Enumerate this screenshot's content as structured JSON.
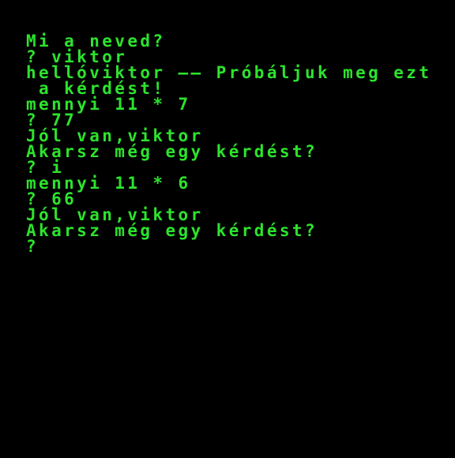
{
  "terminal": {
    "text_color": "#2de32d",
    "background_color": "#000000",
    "lines": [
      "Mi a neved?",
      "? viktor",
      "hellóviktor —— Próbáljuk meg ezt",
      " a kérdést!",
      "mennyi 11 * 7",
      "? 77",
      "Jól van,viktor",
      "Akarsz még egy kérdést?",
      "? i",
      "mennyi 11 * 6",
      "? 66",
      "Jól van,viktor",
      "Akarsz még egy kérdést?",
      "?"
    ]
  }
}
